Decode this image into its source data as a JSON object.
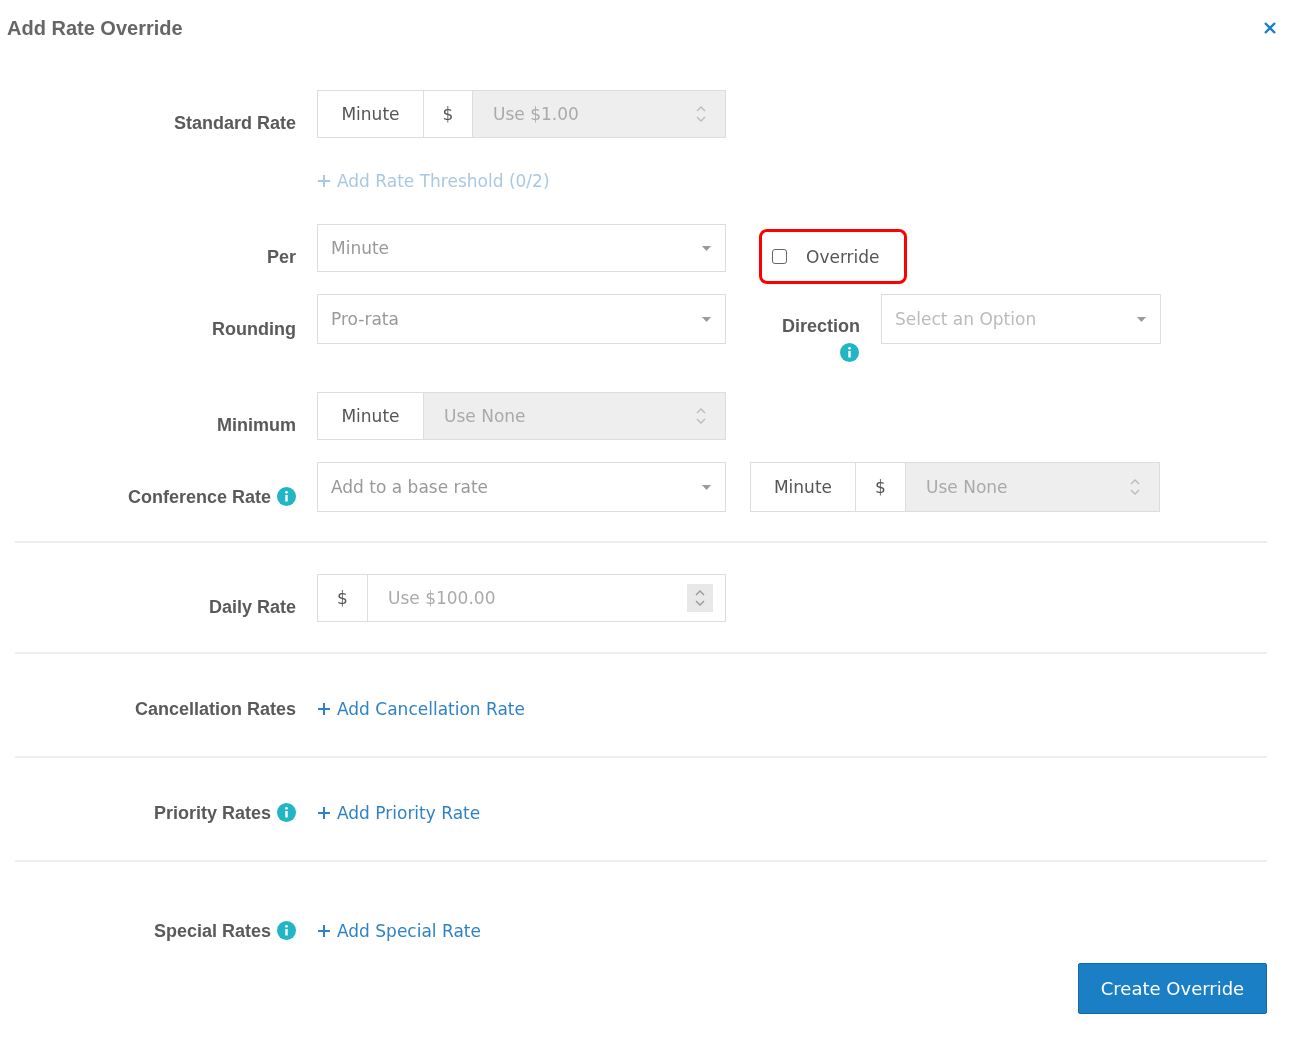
{
  "dialog": {
    "title": "Add Rate Override"
  },
  "standard_rate": {
    "label": "Standard Rate",
    "unit": "Minute",
    "currency": "$",
    "placeholder": "Use $1.00",
    "threshold_link": {
      "label": "Add Rate Threshold (0/2)",
      "disabled": true
    }
  },
  "per": {
    "label": "Per",
    "value": "Minute",
    "override": {
      "label": "Override",
      "checked": false,
      "highlighted": true
    }
  },
  "rounding": {
    "label": "Rounding",
    "value": "Pro-rata",
    "direction": {
      "label": "Direction",
      "info": true,
      "placeholder": "Select an Option"
    }
  },
  "minimum": {
    "label": "Minimum",
    "unit": "Minute",
    "placeholder": "Use None"
  },
  "conference_rate": {
    "label": "Conference Rate",
    "info": true,
    "placeholder": "Add to a base rate",
    "unit": "Minute",
    "currency": "$",
    "amount_placeholder": "Use None"
  },
  "daily_rate": {
    "label": "Daily Rate",
    "currency": "$",
    "placeholder": "Use $100.00"
  },
  "sections": [
    {
      "label": "Cancellation Rates",
      "info": false,
      "link": "Add Cancellation Rate"
    },
    {
      "label": "Priority Rates",
      "info": true,
      "link": "Add Priority Rate"
    },
    {
      "label": "Special Rates",
      "info": true,
      "link": "Add Special Rate"
    }
  ],
  "submit_button": "Create Override"
}
